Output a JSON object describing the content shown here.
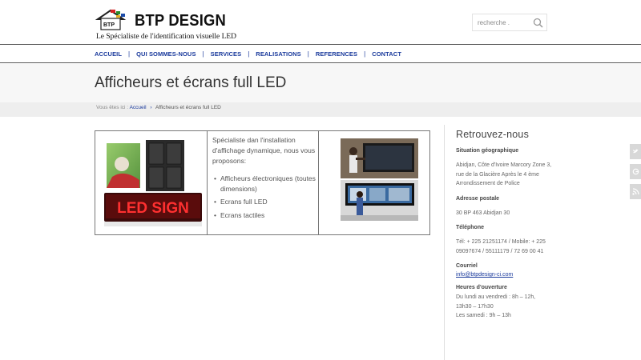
{
  "logo": {
    "mark_text": "BTP",
    "title": "BTP DESIGN",
    "tagline": "Le Spécialiste de l'identification visuelle LED"
  },
  "search": {
    "placeholder": "recherche ."
  },
  "nav": {
    "items": [
      "ACCUEIL",
      "QUI SOMMES-NOUS",
      "SERVICES",
      "REALISATIONS",
      "REFERENCES",
      "CONTACT"
    ],
    "separator": "|"
  },
  "page": {
    "title": "Afficheurs et écrans full LED"
  },
  "breadcrumb": {
    "prefix": "Vous êtes ici :",
    "home": "Accueil",
    "arrow": "›",
    "current": "Afficheurs et écrans full LED"
  },
  "content": {
    "led_sign_text": "LED SIGN",
    "intro": "Spécialiste dan l'installation d'affichage dynamique, nous vous proposons:",
    "features": [
      "Afficheurs électroniques (toutes dimensions)",
      "Ecrans full LED",
      "Ecrans tactiles"
    ]
  },
  "sidebar": {
    "title": "Retrouvez-nous",
    "location_heading": "Situation géographique",
    "location_text": "Abidjan, Côte d'Ivoire Marcory Zone 3, rue de la Glacière Après le 4 ème Arrondissement de Police",
    "postal_heading": "Adresse postale",
    "postal_text": "30 BP 463 Abidjan 30",
    "phone_heading": "Téléphone",
    "phone_text": "Tél: + 225 21251174  / Mobile: + 225 09097674 /  55111179 / 72 69 00 41",
    "email_heading": "Courriel",
    "email": "info@btpdesign-ci.com",
    "hours_heading": "Heures d'ouverture",
    "hours_weekdays": "Du lundi au vendredi : 8h – 12h, 13h30 – 17h30",
    "hours_saturday": "Les samedi : 9h – 13h"
  },
  "share_tabs": [
    "twitter-icon",
    "google-plus-icon",
    "rss-icon"
  ],
  "colors": {
    "link": "#1a3a9c",
    "led_red": "#d42020",
    "band": "#f7f7f7"
  }
}
